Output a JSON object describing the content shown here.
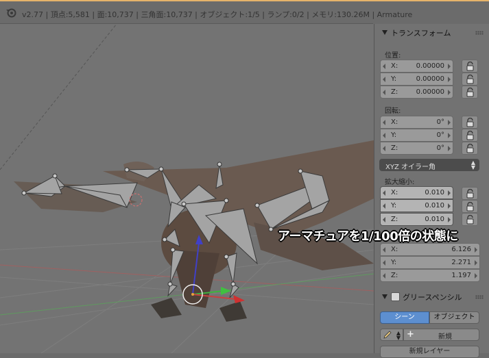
{
  "header": {
    "info": "v2.77 | 頂点:5,581 | 面:10,737 | 三角面:10,737 | オブジェクト:1/5 | ランプ:0/2 | メモリ:130.26M | Armature"
  },
  "colors": {
    "header_accent": "#e6b36a",
    "axis_x": "#d83a3a",
    "axis_y": "#3ac83a",
    "axis_z": "#3a3ad8"
  },
  "transform": {
    "title": "トランスフォーム",
    "location": {
      "label": "位置:",
      "x": {
        "axis": "X:",
        "value": "0.00000"
      },
      "y": {
        "axis": "Y:",
        "value": "0.00000"
      },
      "z": {
        "axis": "Z:",
        "value": "0.00000"
      }
    },
    "rotation": {
      "label": "回転:",
      "x": {
        "axis": "X:",
        "value": "0°"
      },
      "y": {
        "axis": "Y:",
        "value": "0°"
      },
      "z": {
        "axis": "Z:",
        "value": "0°"
      },
      "mode": "XYZ オイラー角"
    },
    "scale": {
      "label": "拡大縮小:",
      "x": {
        "axis": "X:",
        "value": "0.010"
      },
      "y": {
        "axis": "Y:",
        "value": "0.010"
      },
      "z": {
        "axis": "Z:",
        "value": "0.010"
      }
    },
    "dimensions": {
      "x": {
        "axis": "X:",
        "value": "6.126"
      },
      "y": {
        "axis": "Y:",
        "value": "2.271"
      },
      "z": {
        "axis": "Z:",
        "value": "1.197"
      }
    }
  },
  "grease_pencil": {
    "title": "グリースペンシル",
    "tab_scene": "シーン",
    "tab_object": "オブジェクト",
    "new_button": "新規",
    "new_layer_button": "新規レイヤー"
  },
  "overlay": {
    "caption": "アーマチュアを1/100倍の状態に"
  },
  "icons": {
    "logo": "blender-logo-icon",
    "lock": "lock-icon",
    "pencil": "pencil-icon",
    "plus": "plus-icon"
  }
}
